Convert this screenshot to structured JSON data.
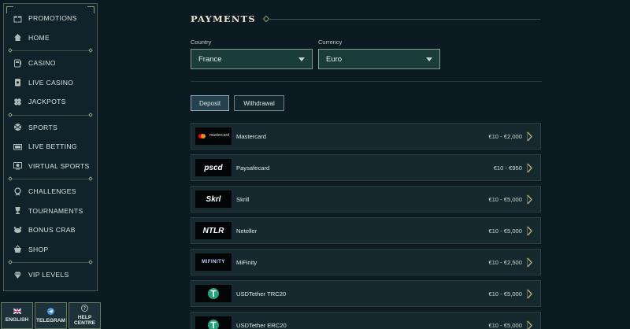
{
  "sidebar": {
    "groups": [
      [
        {
          "label": "PROMOTIONS",
          "icon": "gift-icon"
        },
        {
          "label": "HOME",
          "icon": "home-icon"
        }
      ],
      [
        {
          "label": "CASINO",
          "icon": "slot-machine-icon"
        },
        {
          "label": "LIVE CASINO",
          "icon": "cards-icon"
        },
        {
          "label": "JACKPOTS",
          "icon": "clover-icon"
        }
      ],
      [
        {
          "label": "SPORTS",
          "icon": "ball-icon"
        },
        {
          "label": "LIVE BETTING",
          "icon": "live-icon"
        },
        {
          "label": "VIRTUAL SPORTS",
          "icon": "monitor-icon"
        }
      ],
      [
        {
          "label": "CHALLENGES",
          "icon": "medal-icon"
        },
        {
          "label": "TOURNAMENTS",
          "icon": "trophy-icon"
        },
        {
          "label": "BONUS CRAB",
          "icon": "crab-icon"
        },
        {
          "label": "SHOP",
          "icon": "basket-icon"
        }
      ],
      [
        {
          "label": "VIP LEVELS",
          "icon": "diamond-icon"
        }
      ]
    ]
  },
  "bottom": {
    "language": "ENGLISH",
    "telegram": "TELEGRAM",
    "help": "HELP CENTRE"
  },
  "page": {
    "title": "PAYMENTS",
    "country_label": "Country",
    "country_value": "France",
    "currency_label": "Currency",
    "currency_value": "Euro",
    "tabs": [
      "Deposit",
      "Withdrawal"
    ]
  },
  "methods": [
    {
      "name": "Mastercard",
      "range": "€10 - €2,000",
      "logo": "mastercard"
    },
    {
      "name": "Paysafecard",
      "range": "€10 - €950",
      "logo": "pscd"
    },
    {
      "name": "Skrill",
      "range": "€10 - €5,000",
      "logo": "Skrl"
    },
    {
      "name": "Neteller",
      "range": "€10 - €5,000",
      "logo": "NTLR"
    },
    {
      "name": "MiFinity",
      "range": "€10 - €2,500",
      "logo": "MIFINITY"
    },
    {
      "name": "USDTether TRC20",
      "range": "€10 - €5,000",
      "logo": "tether"
    },
    {
      "name": "USDTether ERC20",
      "range": "€10 - €5,000",
      "logo": "tether"
    }
  ],
  "colors": {
    "background": "#0c1b22",
    "accent": "#9aa284"
  }
}
